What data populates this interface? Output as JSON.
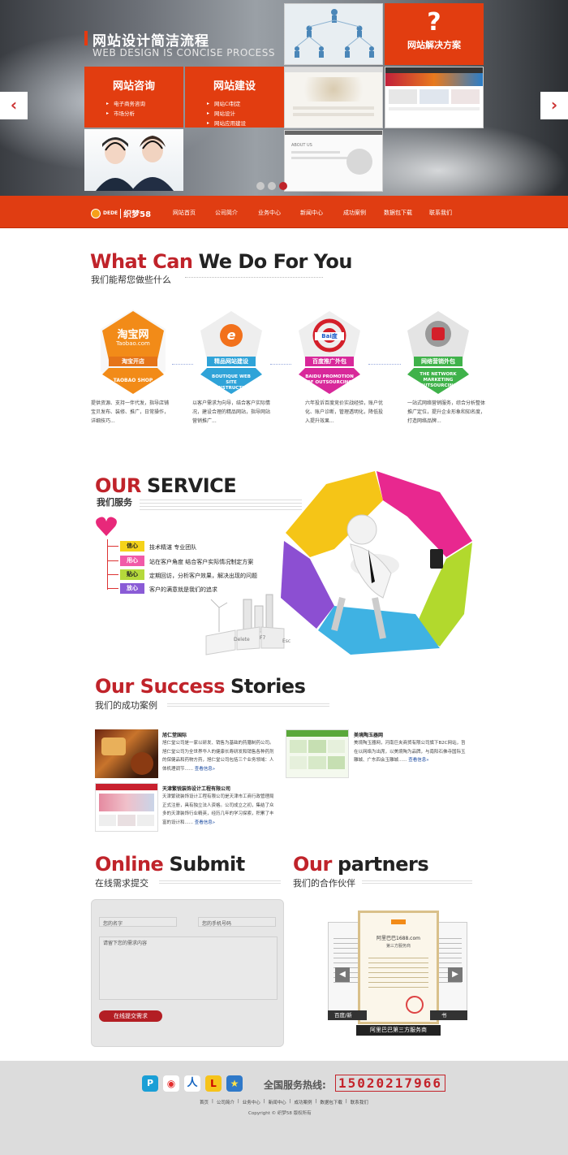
{
  "hero": {
    "title": "网站设计简洁流程",
    "subtitle": "WEB DESIGN IS CONCISE PROCESS",
    "box_consult": {
      "title": "网站咨询",
      "items": [
        "电子商务咨询",
        "市场分析"
      ]
    },
    "box_build": {
      "title": "网站建设",
      "items": [
        "网站CI制定",
        "网站设计",
        "网站应用建设"
      ]
    },
    "box_solution": {
      "title": "网站解决方案",
      "icon_glyph": "?"
    },
    "arrow_prev": "‹",
    "arrow_next": "›",
    "slides": 3,
    "active_slide": 3
  },
  "nav": {
    "logo_badge": "DEDE",
    "logo_text": "织梦58",
    "items": [
      "网站首页",
      "公司简介",
      "业务中心",
      "新闻中心",
      "成功案例",
      "数据包下载",
      "联系我们"
    ]
  },
  "what": {
    "title_red": "What Can",
    "title_black": "We Do For You",
    "subtitle": "我们能帮您做些什么",
    "cards": [
      {
        "logo_text": "淘宝网",
        "logo_sub": "Taobao.com",
        "tag": "淘宝开店",
        "en": "TAOBAO SHOP",
        "color": "#f08a1b",
        "desc": "提供资源、支持一伴代发，指导店铺宝贝发布、装修、推广，日常操作，详细技巧..."
      },
      {
        "logo_text": "e",
        "logo_sub": "",
        "tag": "精品网站建设",
        "en": "BOUTIQUE WEB SITE CONSTRUCTION",
        "color": "#2fa3d8",
        "desc": "以客户需求为向导，结合客户实际情况，建设合理的精品网站，指导网站营销推广..."
      },
      {
        "logo_text": "Bai度",
        "logo_sub": "百度",
        "tag": "百度推广外包",
        "en": "BAIDU PROMOTION OF OUTSOURCING",
        "color": "#d8289a",
        "desc": "六年投诉百度竞价实战经验，账户优化、账户诊断，管理透明化，降低投入提升效果..."
      },
      {
        "logo_text": "",
        "logo_sub": "",
        "tag": "网络营销外包",
        "en": "THE NETWORK MARKETING OUTSOURCING",
        "color": "#3fb24a",
        "desc": "一站式网络营销服务，综合分析整体推广定位，提升企业形象和知名度，打造网络品牌..."
      }
    ]
  },
  "service": {
    "title_red": "OUR",
    "title_black": "SERVICE",
    "subtitle": "我们服务",
    "items": [
      {
        "tag": "信心",
        "text": "技术精湛  专业团队",
        "color": "#f5d31a"
      },
      {
        "tag": "用心",
        "text": "站在客户角度 结合客户实际情况制定方案",
        "color": "#f15aa8"
      },
      {
        "tag": "贴心",
        "text": "定期回访，分析客户效果，解决出现的问题",
        "color": "#b5d93b"
      },
      {
        "tag": "放心",
        "text": "客户的满意就是我们的追求",
        "color": "#8a5bd6"
      }
    ],
    "keys": [
      "Delete",
      "F7",
      "Esc"
    ]
  },
  "stories": {
    "title_red": "Our Success",
    "title_black": "Stories",
    "subtitle": "我们的成功案例",
    "more_label": "查看信息»",
    "items": [
      {
        "title": "旭仁堂国际",
        "body": "旭仁堂公司是一家以研发、销售为基础的药膳制药公司。旭仁堂公司为全世界华人的健康长寿研发和销售各种药剂的保健品和药物方药，旭仁堂公司包括三个业务领域：人体机理调节......"
      },
      {
        "title": "美境陶玉器网",
        "body": "美境陶玉器网，河南巨夹商贸有限公司旗下B2C网站，旨在以网络为出席，以美境陶为品牌，与南阳石佛寺国际玉雕城、广东四会玉雕城......"
      },
      {
        "title": "天津繁锐装饰设计工程有限公司",
        "body": "天津繁锐装饰设计工程有限公司是天津市工商行政管理局正式注册，具有独立法人资格。公司成立之初，集结了众多的天津装饰行业精英，经历几年的学习探索，积累了丰富的设计和......"
      }
    ]
  },
  "submit": {
    "title_red": "Online",
    "title_black": "Submit",
    "subtitle": "在线需求提交",
    "name_placeholder": "您的名字",
    "phone_placeholder": "您的手机号码",
    "content_placeholder": "请留下您的需求内容",
    "button": "在线提交需求"
  },
  "partners": {
    "title_red": "Our",
    "title_black": "partners",
    "subtitle": "我们的合作伙伴",
    "caption_main": "阿里巴巴第三方服务商",
    "caption_left": "百度/新",
    "caption_right": "书",
    "cert_title": "阿里巴巴1688.com",
    "cert_sub": "第三方服务商"
  },
  "footer": {
    "hotline_label": "全国服务热线:",
    "hotline": "15020217966",
    "links": [
      "首页",
      "公司简介",
      "业务中心",
      "新闻中心",
      "成功案例",
      "数据包下载",
      "联系我们"
    ],
    "copyright": "Copyright © 织梦58 版权所有"
  }
}
